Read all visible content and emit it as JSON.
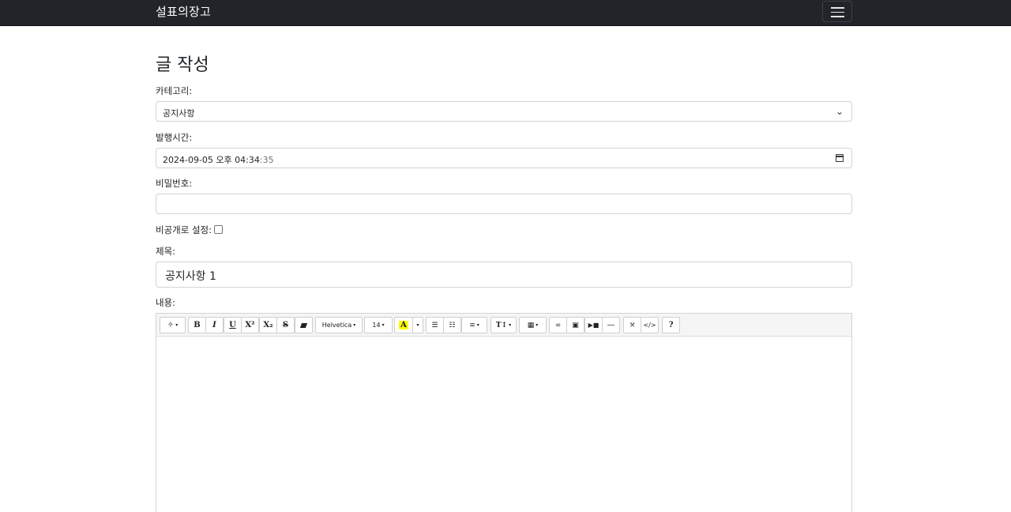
{
  "navbar": {
    "brand": "설표의장고",
    "toggler_icon": "hamburger-icon"
  },
  "page": {
    "title": "글 작성"
  },
  "form": {
    "category": {
      "label": "카테고리:",
      "value": "공지사항"
    },
    "publish_time": {
      "label": "발행시간:",
      "value_main": "2024-09-05 오후 04:34",
      "value_seconds": ":35"
    },
    "password": {
      "label": "비밀번호:",
      "value": ""
    },
    "private": {
      "label": "비공개로 설정:",
      "checked": false
    },
    "title": {
      "label": "제목:",
      "value": "공지사항 1"
    },
    "content": {
      "label": "내용:"
    }
  },
  "toolbar": {
    "style_icon": "magic-wand-icon",
    "bold": "B",
    "italic": "I",
    "underline": "U",
    "superscript": "X²",
    "subscript": "X₂",
    "strikethrough": "S",
    "eraser_icon": "eraser-icon",
    "font_name": "Helvetica",
    "font_size": "14",
    "color": "A",
    "unordered_list_icon": "unordered-list-icon",
    "ordered_list_icon": "ordered-list-icon",
    "align_icon": "align-icon",
    "line_height": "T↕",
    "table_icon": "table-icon",
    "link_icon": "link-icon",
    "picture_icon": "picture-icon",
    "video_icon": "video-icon",
    "hr": "—",
    "fullscreen_icon": "fullscreen-icon",
    "codeview": "</>",
    "help": "?",
    "highlight_color": "#ffff00"
  }
}
